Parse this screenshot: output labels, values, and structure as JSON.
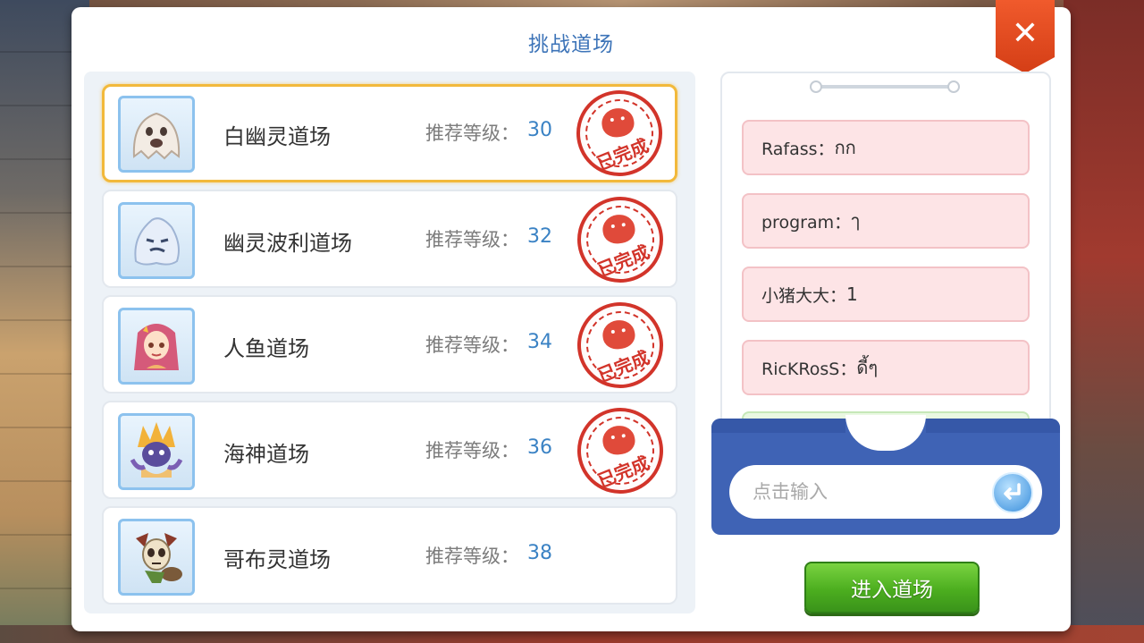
{
  "dialog": {
    "title": "挑战道场",
    "close_label": "✕"
  },
  "dojo_list": [
    {
      "name": "白幽灵道场",
      "rec_label": "推荐等级：",
      "level": "30",
      "completed": true,
      "stamp_text": "已完成",
      "avatar": "white-ghost-avatar",
      "selected": true
    },
    {
      "name": "幽灵波利道场",
      "rec_label": "推荐等级：",
      "level": "32",
      "completed": true,
      "stamp_text": "已完成",
      "avatar": "ghost-poring-avatar",
      "selected": false
    },
    {
      "name": "人鱼道场",
      "rec_label": "推荐等级：",
      "level": "34",
      "completed": true,
      "stamp_text": "已完成",
      "avatar": "mermaid-avatar",
      "selected": false
    },
    {
      "name": "海神道场",
      "rec_label": "推荐等级：",
      "level": "36",
      "completed": true,
      "stamp_text": "已完成",
      "avatar": "sea-god-avatar",
      "selected": false
    },
    {
      "name": "哥布灵道场",
      "rec_label": "推荐等级：",
      "level": "38",
      "completed": false,
      "stamp_text": "",
      "avatar": "goblin-avatar",
      "selected": false
    }
  ],
  "chat": {
    "messages": [
      {
        "user": "Rafass：",
        "text": "กก"
      },
      {
        "user": "program：",
        "text": "ๅ"
      },
      {
        "user": "小猪大大：",
        "text": "1"
      },
      {
        "user": "RicKRosS：",
        "text": "ดี้ๆ"
      }
    ],
    "input_placeholder": "点击输入"
  },
  "enter_button": "进入道场",
  "colors": {
    "title": "#3d74b8",
    "level": "#3a82c4",
    "selected_border": "#f2b93b",
    "stamp": "#d2342a",
    "chat_bubble": "#fde4e6",
    "input_tray": "#3f63b5",
    "enter_button": "#4cae1f",
    "close_button": "#e0481f"
  }
}
